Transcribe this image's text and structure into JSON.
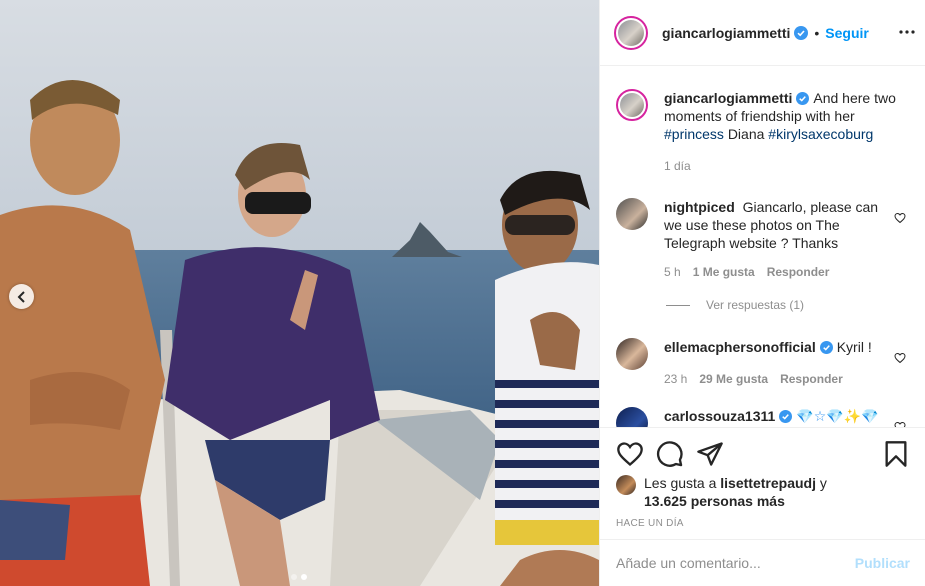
{
  "header": {
    "username": "giancarlogiammetti",
    "follow_label": "Seguir",
    "separator": "•"
  },
  "caption": {
    "username": "giancarlogiammetti",
    "text": "And here two moments of friendship with her",
    "hashtag1": "#princess",
    "plain": "Diana",
    "hashtag2": "#kirylsaxecoburg",
    "age": "1 día"
  },
  "comments": [
    {
      "username": "nightpiced",
      "text": "Giancarlo, please can we use these photos on The Telegraph website ? Thanks",
      "age": "5 h",
      "likes": "1 Me gusta",
      "reply_label": "Responder",
      "view_replies": "Ver respuestas (1)"
    },
    {
      "username": "ellemacphersonofficial",
      "text": "Kyril !",
      "age": "23 h",
      "likes": "29 Me gusta",
      "reply_label": "Responder"
    },
    {
      "username": "carlossouza1311",
      "text": "💎☆💎✨💎"
    }
  ],
  "likes": {
    "prefix": "Les gusta a",
    "user": "lisettetrepaudj",
    "conj": "y",
    "count": "13.625 personas más"
  },
  "timestamp": "Hace un día",
  "add_comment": {
    "placeholder": "Añade un comentario...",
    "publish_label": "Publicar"
  },
  "colors": {
    "accent": "#0095f6",
    "publish_disabled": "#b2dffc",
    "muted": "#8e8e8e",
    "hashtag": "#00376b"
  },
  "carousel": {
    "slides": 2,
    "active": 2
  }
}
